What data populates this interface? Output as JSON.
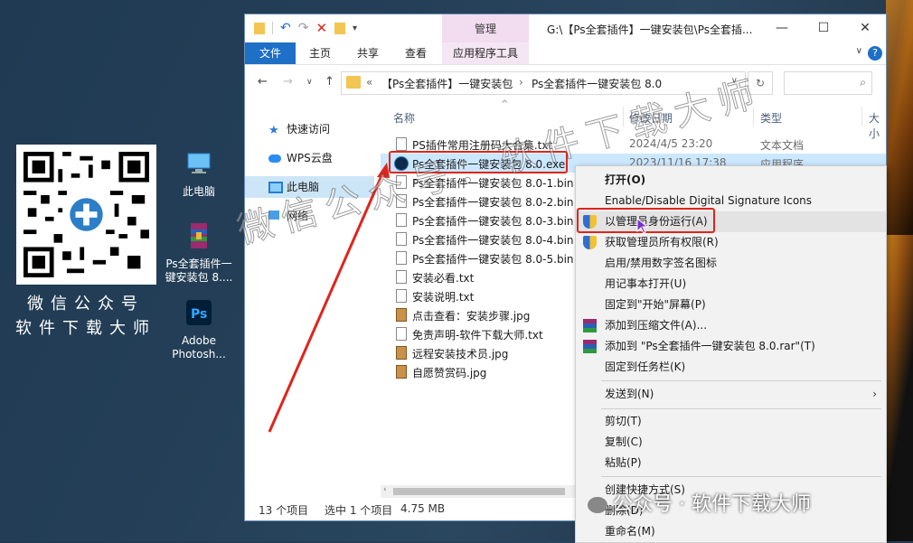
{
  "desktop": {
    "qr_caption_line1": "微信公众号",
    "qr_caption_line2": "软件下载大师",
    "icons": [
      {
        "label": "此电脑"
      },
      {
        "label": "Ps全套插件一键安装包 8...."
      },
      {
        "label": "Adobe Photosh..."
      }
    ]
  },
  "window": {
    "manage_tab": "管理",
    "title": "G:\\【Ps全套插件】一键安装包\\Ps全套插...",
    "ribbon": {
      "file": "文件",
      "home": "主页",
      "share": "共享",
      "view": "查看",
      "app_tools": "应用程序工具"
    },
    "address": {
      "prefix": "«",
      "crumb1": "【Ps全套插件】一键安装包",
      "crumb2": "Ps全套插件一键安装包 8.0"
    },
    "nav": [
      {
        "label": "快速访问"
      },
      {
        "label": "WPS云盘"
      },
      {
        "label": "此电脑"
      },
      {
        "label": "网络"
      }
    ],
    "columns": {
      "name": "名称",
      "modified": "修改日期",
      "type": "类型",
      "size": "大小"
    },
    "files": [
      {
        "name": "PS插件常用注册码大合集.txt",
        "date": "2024/4/5 23:20",
        "type": "文本文档",
        "kind": "txt"
      },
      {
        "name": "Ps全套插件一键安装包 8.0.exe",
        "date": "2023/11/16 17:38",
        "type": "应用程序",
        "kind": "exe"
      },
      {
        "name": "Ps全套插件一键安装包 8.0-1.bin",
        "date": "",
        "type": "",
        "kind": "bin"
      },
      {
        "name": "Ps全套插件一键安装包 8.0-2.bin",
        "date": "",
        "type": "",
        "kind": "bin"
      },
      {
        "name": "Ps全套插件一键安装包 8.0-3.bin",
        "date": "",
        "type": "",
        "kind": "bin"
      },
      {
        "name": "Ps全套插件一键安装包 8.0-4.bin",
        "date": "",
        "type": "",
        "kind": "bin"
      },
      {
        "name": "Ps全套插件一键安装包 8.0-5.bin",
        "date": "",
        "type": "",
        "kind": "bin"
      },
      {
        "name": "安装必看.txt",
        "date": "",
        "type": "",
        "kind": "txt"
      },
      {
        "name": "安装说明.txt",
        "date": "",
        "type": "",
        "kind": "txt"
      },
      {
        "name": "点击查看：安装步骤.jpg",
        "date": "",
        "type": "",
        "kind": "jpg"
      },
      {
        "name": "免责声明-软件下载大师.txt",
        "date": "",
        "type": "",
        "kind": "txt"
      },
      {
        "name": "远程安装技术员.jpg",
        "date": "",
        "type": "",
        "kind": "jpg"
      },
      {
        "name": "自愿赞赏码.jpg",
        "date": "",
        "type": "",
        "kind": "jpg"
      }
    ],
    "status": {
      "count": "13 个项目",
      "selected": "选中 1 个项目",
      "size": "4.75 MB"
    }
  },
  "context_menu": [
    {
      "label": "打开(O)",
      "bold": true
    },
    {
      "label": "Enable/Disable Digital Signature Icons"
    },
    {
      "label": "以管理员身份运行(A)",
      "icon": "shield"
    },
    {
      "label": "获取管理员所有权限(R)",
      "icon": "shield"
    },
    {
      "label": "启用/禁用数字签名图标"
    },
    {
      "label": "用记事本打开(U)"
    },
    {
      "label": "固定到\"开始\"屏幕(P)"
    },
    {
      "label": "添加到压缩文件(A)...",
      "icon": "rar"
    },
    {
      "label": "添加到 \"Ps全套插件一键安装包 8.0.rar\"(T)",
      "icon": "rar"
    },
    {
      "label": "固定到任务栏(K)"
    },
    {
      "label": "发送到(N)",
      "submenu": true
    },
    {
      "label": "剪切(T)"
    },
    {
      "label": "复制(C)"
    },
    {
      "label": "粘贴(P)"
    },
    {
      "label": "创建快捷方式(S)"
    },
    {
      "label": "删除(D)"
    },
    {
      "label": "重命名(M)"
    }
  ],
  "watermark": "微信公众号：软件下载大师",
  "watermark_bottom": "公众号 · 软件下载大师"
}
